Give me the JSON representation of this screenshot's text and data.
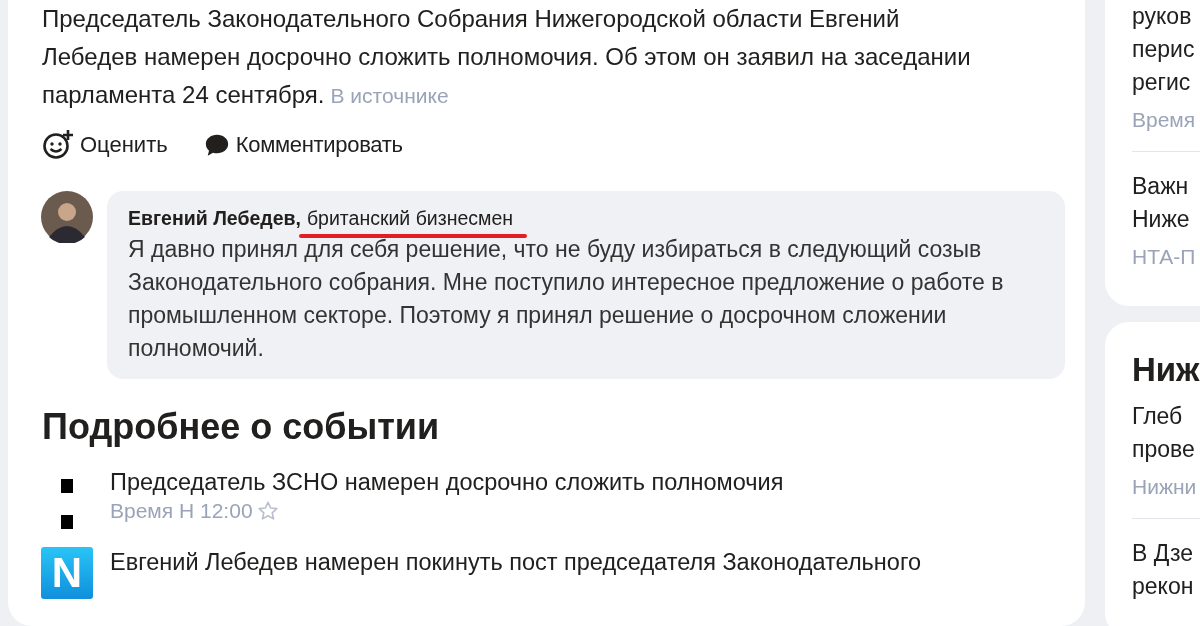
{
  "article": {
    "lead": "Председатель Законодательного Собрания Нижегородской области Евгений Лебедев намерен досрочно сложить полномочия. Об этом он заявил на заседании парламента 24 сентября.",
    "source_link": "В источнике",
    "actions": [
      {
        "kind": "rate",
        "label": "Оценить"
      },
      {
        "kind": "comment",
        "label": "Комментировать"
      }
    ]
  },
  "quote": {
    "author": "Евгений Лебедев,",
    "role": "британский бизнесмен",
    "underlined": true,
    "text": "Я давно принял для себя решение, что не буду избираться в следующий созыв Законодательного собрания. Мне поступило интересное предложение о работе в промышленном секторе. Поэтому я принял решение о досрочном сложении полномочий."
  },
  "related": {
    "title": "Подробнее о событии",
    "items": [
      {
        "kind": "bullet",
        "title": "Председатель ЗСНО намерен досрочно сложить полномочия",
        "source": "Время Н 12:00"
      },
      {
        "kind": "logo",
        "logo_letter": "N",
        "title": "Евгений Лебедев намерен покинуть пост председателя Законодательного"
      }
    ]
  },
  "sidebar": {
    "cards": [
      {
        "items": [
          {
            "lines": [
              "руков",
              "перис",
              "регис"
            ],
            "source": "Время"
          },
          {
            "lines": [
              "Важн",
              "Ниже"
            ],
            "source": "НТА-П"
          }
        ]
      },
      {
        "title": "Ниж",
        "items": [
          {
            "lines": [
              "Глеб",
              "прове"
            ],
            "source": "Нижни"
          },
          {
            "lines": [
              "В Дзе",
              "рекон"
            ]
          }
        ]
      }
    ]
  }
}
